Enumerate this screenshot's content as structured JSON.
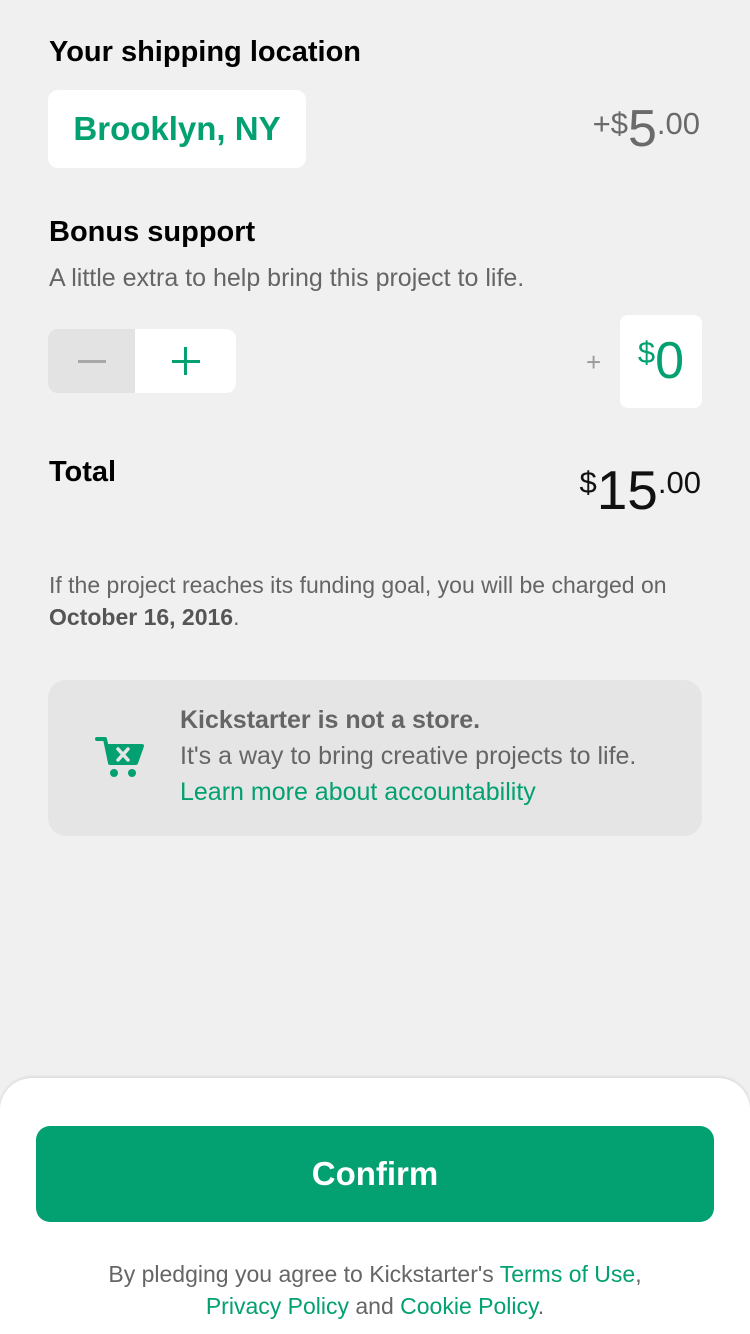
{
  "shipping": {
    "title": "Your shipping location",
    "location": "Brooklyn, NY",
    "cost_prefix": "+$",
    "cost_whole": "5",
    "cost_cents": ".00"
  },
  "bonus": {
    "title": "Bonus support",
    "subtitle": "A little extra to help bring this project to life.",
    "plus_sign": "+",
    "amount_symbol": "$",
    "amount_value": "0"
  },
  "total": {
    "label": "Total",
    "symbol": "$",
    "whole": "15",
    "cents": ".00"
  },
  "charge_note": {
    "text": "If the project reaches its funding goal, you will be charged on ",
    "date": "October 16, 2016",
    "end": "."
  },
  "info": {
    "heading": "Kickstarter is not a store.",
    "body": "It's a way to bring creative projects to life. ",
    "link": "Learn more about accountability"
  },
  "footer": {
    "confirm_label": "Confirm",
    "legal_prefix": "By pledging you agree to Kickstarter's ",
    "terms": "Terms of Use",
    "comma": ", ",
    "privacy": "Privacy Policy",
    "and": " and ",
    "cookie": "Cookie Policy",
    "end": "."
  },
  "colors": {
    "accent": "#03a071",
    "background": "#f0f0f0",
    "muted_text": "#656565"
  }
}
